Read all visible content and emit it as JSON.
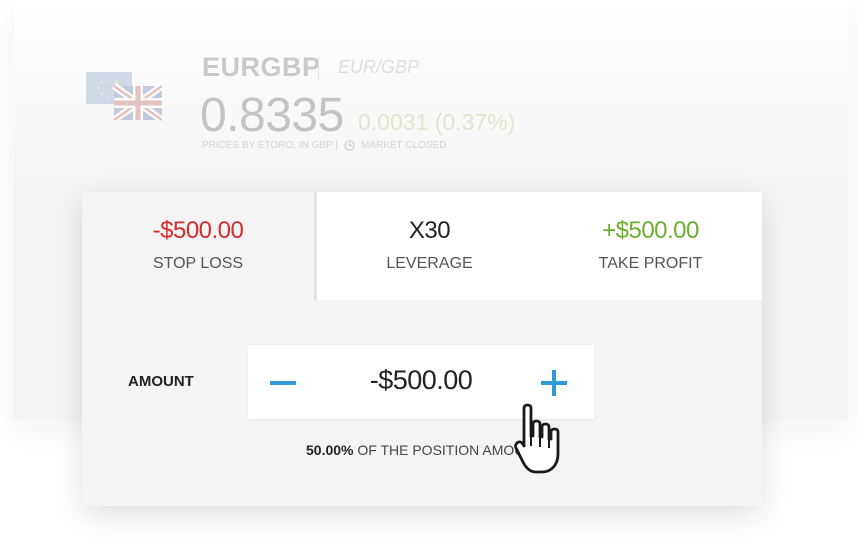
{
  "instrument": {
    "symbol": "EURGBP",
    "pair": "EUR/GBP",
    "price": "0.8335",
    "change": "0.0031 (0.37%)",
    "meta_prices": "PRICES BY ETORO, IN GBP |",
    "meta_status": "MARKET CLOSED"
  },
  "tabs": {
    "stop_loss": {
      "value": "-$500.00",
      "label": "STOP LOSS"
    },
    "leverage": {
      "value": "X30",
      "label": "LEVERAGE"
    },
    "take_profit": {
      "value": "+$500.00",
      "label": "TAKE PROFIT"
    }
  },
  "amount": {
    "label": "AMOUNT",
    "value": "-$500.00",
    "percent": "50.00%",
    "percent_text": " OF THE POSITION AMOUNT"
  },
  "colors": {
    "loss": "#d62b2b",
    "profit": "#6ab02f",
    "accent": "#2f9ad8"
  },
  "icons": [
    "eu-flag-icon",
    "uk-flag-icon",
    "clock-icon",
    "minus-icon",
    "plus-icon",
    "hand-cursor-icon"
  ]
}
